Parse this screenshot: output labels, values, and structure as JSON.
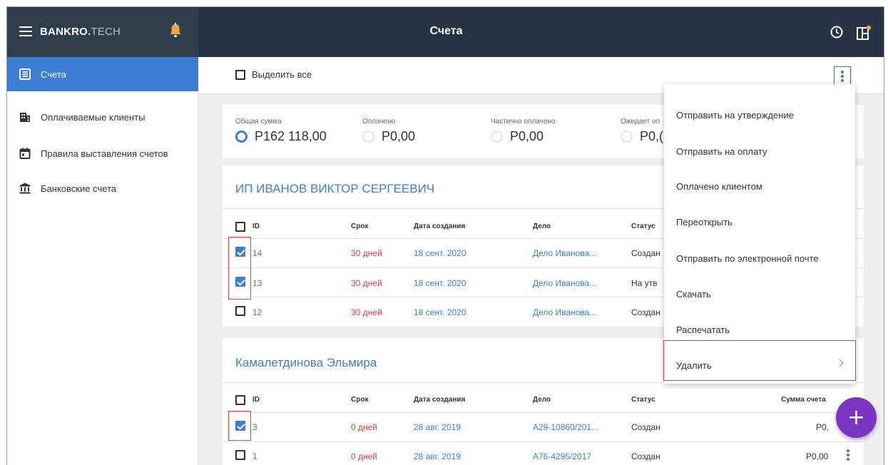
{
  "header": {
    "brand_bold": "BANKRO.",
    "brand_light": "TECH",
    "title": "Счета"
  },
  "sidebar": {
    "items": [
      {
        "label": "Счета",
        "icon": "invoices-icon",
        "active": true
      },
      {
        "label": "Оплачиваемые клиенты",
        "icon": "clients-icon"
      },
      {
        "label": "Правила выставления счетов",
        "icon": "calendar-icon"
      },
      {
        "label": "Банковские счета",
        "icon": "bank-icon"
      }
    ]
  },
  "toolbar": {
    "select_all_label": "Выделить все"
  },
  "summary": {
    "columns": [
      {
        "label": "Общая сумма",
        "value": "P162 118,00"
      },
      {
        "label": "Оплачено",
        "value": "P0,00"
      },
      {
        "label": "Частично оплачено",
        "value": "P0,00"
      },
      {
        "label": "Ожидает оп",
        "value": "P0,("
      }
    ]
  },
  "table_headers": {
    "id": "ID",
    "term": "Срок",
    "created": "Дата создания",
    "case": "Дело",
    "status": "Статус",
    "amount": "Сумма счета"
  },
  "groups": [
    {
      "title": "ИП ИВАНОВ ВИКТОР СЕРГЕЕВИЧ",
      "rows": [
        {
          "id": "14",
          "term": "30 дней",
          "created": "18 сент. 2020",
          "case": "Дело Иванова...",
          "status": "Создан",
          "checked": true
        },
        {
          "id": "13",
          "term": "30 дней",
          "created": "18 сент. 2020",
          "case": "Дело Иванова...",
          "status": "На утв",
          "checked": true
        },
        {
          "id": "12",
          "term": "30 дней",
          "created": "18 сент. 2020",
          "case": "Дело Иванова...",
          "status": "Создан",
          "checked": false
        }
      ]
    },
    {
      "title": "Камалетдинова Эльмира",
      "rows": [
        {
          "id": "3",
          "term": "0 дней",
          "created": "28 авг. 2019",
          "case": "A29-10860/201...",
          "status": "Создан",
          "amount": "P0,",
          "checked": true
        },
        {
          "id": "1",
          "term": "0 дней",
          "created": "28 авг. 2019",
          "case": "A76-4295/2017",
          "status": "Создан",
          "amount": "P0,00",
          "checked": false
        }
      ]
    }
  ],
  "menu": {
    "items": [
      "Отправить на утверждение",
      "Отправить на оплату",
      "Оплачено клиентом",
      "Переоткрыть",
      "Отправить по электронной почте",
      "Скачать",
      "Распечатать",
      "Удалить"
    ]
  },
  "fab": {
    "label": "+"
  },
  "colors": {
    "accent": "#3b7ed4",
    "topbar": "#263445",
    "highlight": "#e03a3a",
    "fab": "#7a36c2",
    "term_red": "#e23b3b"
  }
}
